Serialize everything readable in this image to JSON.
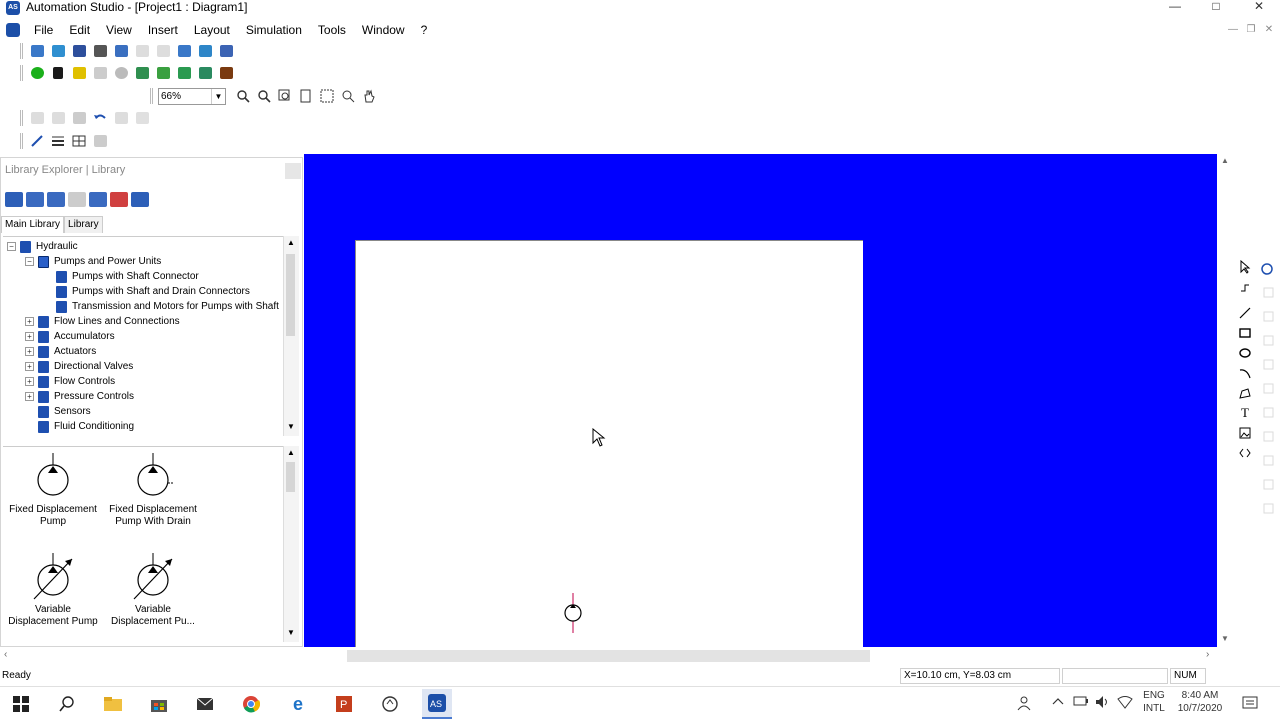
{
  "window": {
    "title": "Automation Studio - [Project1 : Diagram1]"
  },
  "menu": [
    "File",
    "Edit",
    "View",
    "Insert",
    "Layout",
    "Simulation",
    "Tools",
    "Window",
    "?"
  ],
  "toolbar": {
    "zoom_value": "66%"
  },
  "library_panel": {
    "header": "Library Explorer | Library",
    "tabs": [
      "Main Library",
      "Library"
    ],
    "tree": [
      {
        "label": "Hydraulic",
        "level": 0,
        "exp": "-"
      },
      {
        "label": "Pumps and Power Units",
        "level": 1,
        "exp": "-"
      },
      {
        "label": "Pumps with Shaft Connector",
        "level": 2,
        "exp": ""
      },
      {
        "label": "Pumps with Shaft and Drain Connectors",
        "level": 2,
        "exp": ""
      },
      {
        "label": "Transmission and Motors for Pumps with Shaft",
        "level": 2,
        "exp": ""
      },
      {
        "label": "Flow Lines and Connections",
        "level": 1,
        "exp": "+"
      },
      {
        "label": "Accumulators",
        "level": 1,
        "exp": "+"
      },
      {
        "label": "Actuators",
        "level": 1,
        "exp": "+"
      },
      {
        "label": "Directional Valves",
        "level": 1,
        "exp": "+"
      },
      {
        "label": "Flow Controls",
        "level": 1,
        "exp": "+"
      },
      {
        "label": "Pressure Controls",
        "level": 1,
        "exp": "+"
      },
      {
        "label": "Sensors",
        "level": 1,
        "exp": ""
      },
      {
        "label": "Fluid Conditioning",
        "level": 1,
        "exp": ""
      }
    ],
    "components": [
      {
        "line1": "Fixed Displacement",
        "line2": "Pump",
        "icon": "fixed-pump-icon"
      },
      {
        "line1": "Fixed Displacement",
        "line2": "Pump With Drain",
        "icon": "fixed-pump-drain-icon"
      },
      {
        "line1": "Variable",
        "line2": "Displacement Pump",
        "icon": "variable-pump-icon"
      },
      {
        "line1": "Variable",
        "line2": "Displacement Pu...",
        "icon": "variable-pump-drain-icon"
      }
    ]
  },
  "status": {
    "text": "Ready",
    "coords": "X=10.10 cm, Y=8.03 cm",
    "num": "NUM"
  },
  "taskbar": {
    "lang1": "ENG",
    "lang2": "INTL",
    "time": "8:40 AM",
    "date": "10/7/2020"
  },
  "colors": {
    "canvas": "#0000ff",
    "accent": "#1e4fb0"
  }
}
